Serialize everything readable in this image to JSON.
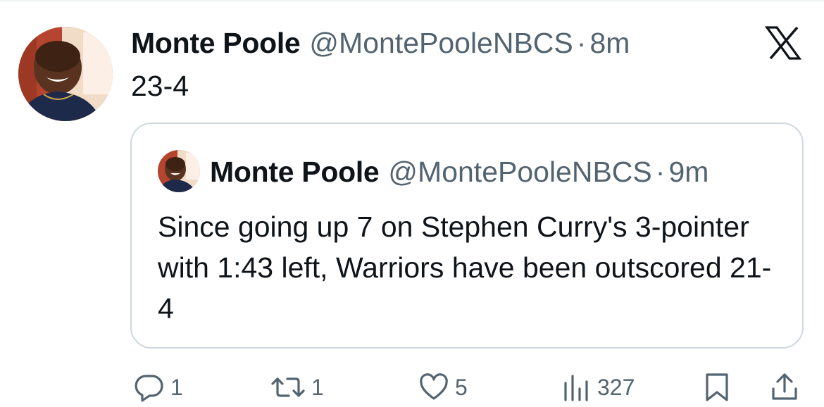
{
  "tweet": {
    "author_name": "Monte Poole",
    "handle": "@MontePooleNBCS",
    "separator": "·",
    "time": "8m",
    "text": "23-4",
    "avatar_icon": "profile-photo"
  },
  "quoted_tweet": {
    "author_name": "Monte Poole",
    "handle": "@MontePooleNBCS",
    "separator": "·",
    "time": "9m",
    "text": "Since going up 7 on Stephen Curry's 3-pointer with 1:43 left, Warriors have been outscored 21-4"
  },
  "actions": {
    "reply_count": "1",
    "retweet_count": "1",
    "like_count": "5",
    "views_count": "327"
  },
  "icons": {
    "brand": "x-logo",
    "reply": "reply-icon",
    "retweet": "retweet-icon",
    "like": "heart-icon",
    "views": "views-icon",
    "bookmark": "bookmark-icon",
    "share": "share-icon"
  },
  "colors": {
    "text": "#0f1419",
    "secondary": "#536471",
    "border": "#cfd9de"
  }
}
